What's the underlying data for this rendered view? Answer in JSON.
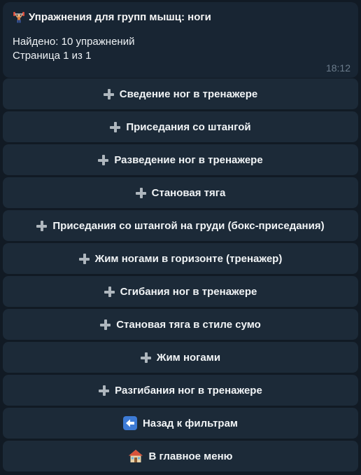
{
  "message": {
    "title": "Упражнения для групп мышц: ноги",
    "found": "Найдено: 10 упражнений",
    "page": "Страница 1 из 1",
    "time": "18:12"
  },
  "keyboard": {
    "exercises": [
      "Сведение ног в тренажере",
      "Приседания со штангой",
      "Разведение ног в тренажере",
      "Становая тяга",
      "Приседания со штангой на груди (бокс-приседания)",
      "Жим ногами в горизонте (тренажер)",
      "Сгибания ног в тренажере",
      "Становая тяга в стиле сумо",
      "Жим ногами",
      "Разгибания ног в тренажере"
    ],
    "back_label": "Назад к фильтрам",
    "home_label": "В главное меню"
  }
}
